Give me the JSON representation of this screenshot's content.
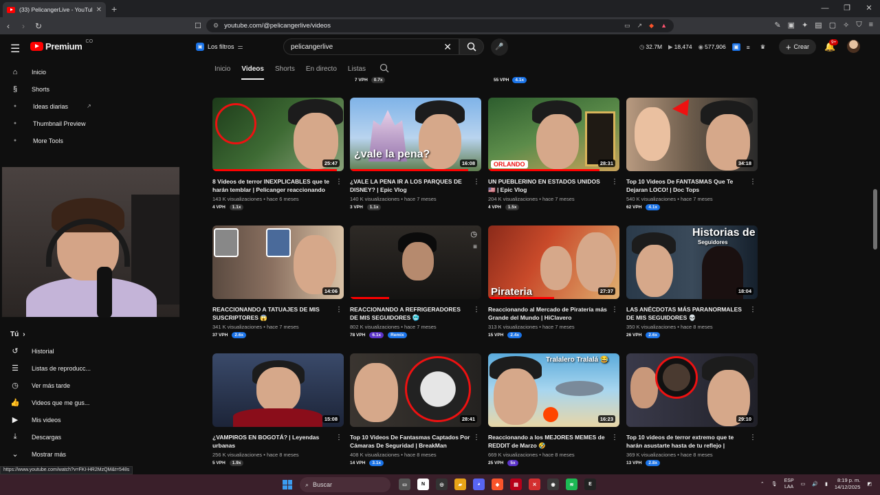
{
  "browser": {
    "tab_title": "(33) PelicangerLive - YouTube",
    "url": "youtube.com/@pelicangerlive/videos",
    "status_url": "https://www.youtube.com/watch?v=FKI-HR2MzQM&t=548s"
  },
  "header": {
    "logo_text": "Premium",
    "logo_suffix": "CO",
    "filters_label": "Los filtros",
    "search_value": "pelicangerlive",
    "stats": [
      "32.7M",
      "18,474",
      "577,906"
    ],
    "create_label": "Crear",
    "notif_count": "9+"
  },
  "sidebar": {
    "items": [
      {
        "label": "Inicio",
        "icon": "home-icon"
      },
      {
        "label": "Shorts",
        "icon": "shorts-icon"
      }
    ],
    "extensions": [
      {
        "label": "Ideas diarias"
      },
      {
        "label": "Thumbnail Preview"
      },
      {
        "label": "More Tools"
      }
    ],
    "you_label": "Tú",
    "you_items": [
      {
        "label": "Historial"
      },
      {
        "label": "Listas de reproducc..."
      },
      {
        "label": "Ver más tarde"
      },
      {
        "label": "Videos que me gus..."
      },
      {
        "label": "Mis videos"
      },
      {
        "label": "Descargas"
      },
      {
        "label": "Mostrar más"
      }
    ]
  },
  "channel_tabs": [
    "Inicio",
    "Videos",
    "Shorts",
    "En directo",
    "Listas"
  ],
  "top_strip": [
    {
      "vph": "7 VPH",
      "x": "0.7x"
    },
    {
      "vph": "55 VPH",
      "x": "4.1x"
    }
  ],
  "videos": [
    {
      "title": "8 Vídeos de terror INEXPLICABLES que te harán temblar | Pelicanger reaccionando a...",
      "views": "143 K visualizaciones",
      "age": "hace 6 meses",
      "duration": "25:47",
      "vph": "4 VPH",
      "mult": "1.1x",
      "blue": false,
      "progress": 0.95
    },
    {
      "title": "¿VALE LA PENA IR A LOS PARQUES DE DISNEY? | Epic Vlog",
      "views": "140 K visualizaciones",
      "age": "hace 7 meses",
      "duration": "16:08",
      "vph": "3 VPH",
      "mult": "1.1x",
      "blue": false,
      "progress": 0.9,
      "overlay": "¿vale la pena?"
    },
    {
      "title": "UN PUEBLERINO EN ESTADOS UNIDOS 🇺🇸 | Epic Vlog",
      "views": "204 K visualizaciones",
      "age": "hace 7 meses",
      "duration": "28:31",
      "vph": "4 VPH",
      "mult": "1.5x",
      "blue": false,
      "progress": 0.85,
      "overlay": "ORLANDO"
    },
    {
      "title": "Top 10 Videos De FANTASMAS Que Te Dejaran LOCO! | Doc Tops",
      "views": "540 K visualizaciones",
      "age": "hace 7 meses",
      "duration": "34:18",
      "vph": "62 VPH",
      "mult": "4.1x",
      "blue": true,
      "progress": 0
    },
    {
      "title": "REACCIONANDO A TATUAJES DE MIS SUSCRIPTORES 😱",
      "views": "341 K visualizaciones",
      "age": "hace 7 meses",
      "duration": "14:06",
      "vph": "37 VPH",
      "mult": "2.6x",
      "blue": true,
      "progress": 0
    },
    {
      "title": "REACCIONANDO A REFRIGERADORES DE MIS SEGUIDORES 🥶",
      "views": "802 K visualizaciones",
      "age": "hace 7 meses",
      "duration": "",
      "vph": "78 VPH",
      "mult": "6.1x",
      "blue": true,
      "remix": "Remix",
      "progress": 0.3
    },
    {
      "title": "Reaccionando al Mercado de Piratería más Grande del Mundo | HiClavero",
      "views": "313 K visualizaciones",
      "age": "hace 7 meses",
      "duration": "27:37",
      "vph": "15 VPH",
      "mult": "2.4x",
      "blue": true,
      "progress": 0.5,
      "overlay": "Pirateria"
    },
    {
      "title": "LAS ANÉCDOTAS MÁS PARANORMALES DE MIS SEGUIDORES 💀",
      "views": "350 K visualizaciones",
      "age": "hace 8 meses",
      "duration": "18:04",
      "vph": "26 VPH",
      "mult": "2.6x",
      "blue": true,
      "progress": 0,
      "overlay": "Historias de",
      "overlay2": "Seguidores"
    },
    {
      "title": "¿VAMPIROS EN BOGOTÁ? | Leyendas urbanas",
      "views": "256 K visualizaciones",
      "age": "hace 8 meses",
      "duration": "15:08",
      "vph": "5 VPH",
      "mult": "1.9x",
      "blue": false,
      "progress": 0
    },
    {
      "title": "Top 10 Videos De Fantasmas Captados Por Cámaras De Seguridad | BreakMan",
      "views": "408 K visualizaciones",
      "age": "hace 8 meses",
      "duration": "28:41",
      "vph": "14 VPH",
      "mult": "3.1x",
      "blue": true,
      "progress": 0
    },
    {
      "title": "Reaccionando a los MEJORES MEMES de REDDIT de Marzo 🤣",
      "views": "669 K visualizaciones",
      "age": "hace 8 meses",
      "duration": "16:23",
      "vph": "25 VPH",
      "mult": "5x",
      "blue": "purple",
      "progress": 0,
      "overlay": "Tralalero Tralalá 😂"
    },
    {
      "title": "Top 10 videos de terror extremo que te harán asustarte hasta de tu reflejo | BreakMan",
      "views": "369 K visualizaciones",
      "age": "hace 8 meses",
      "duration": "29:10",
      "vph": "13 VPH",
      "mult": "2.8x",
      "blue": true,
      "progress": 0
    }
  ],
  "taskbar": {
    "search_label": "Buscar",
    "lang": "ESP",
    "lang2": "LAA",
    "time": "8:19 p. m.",
    "date": "14/12/2025"
  }
}
